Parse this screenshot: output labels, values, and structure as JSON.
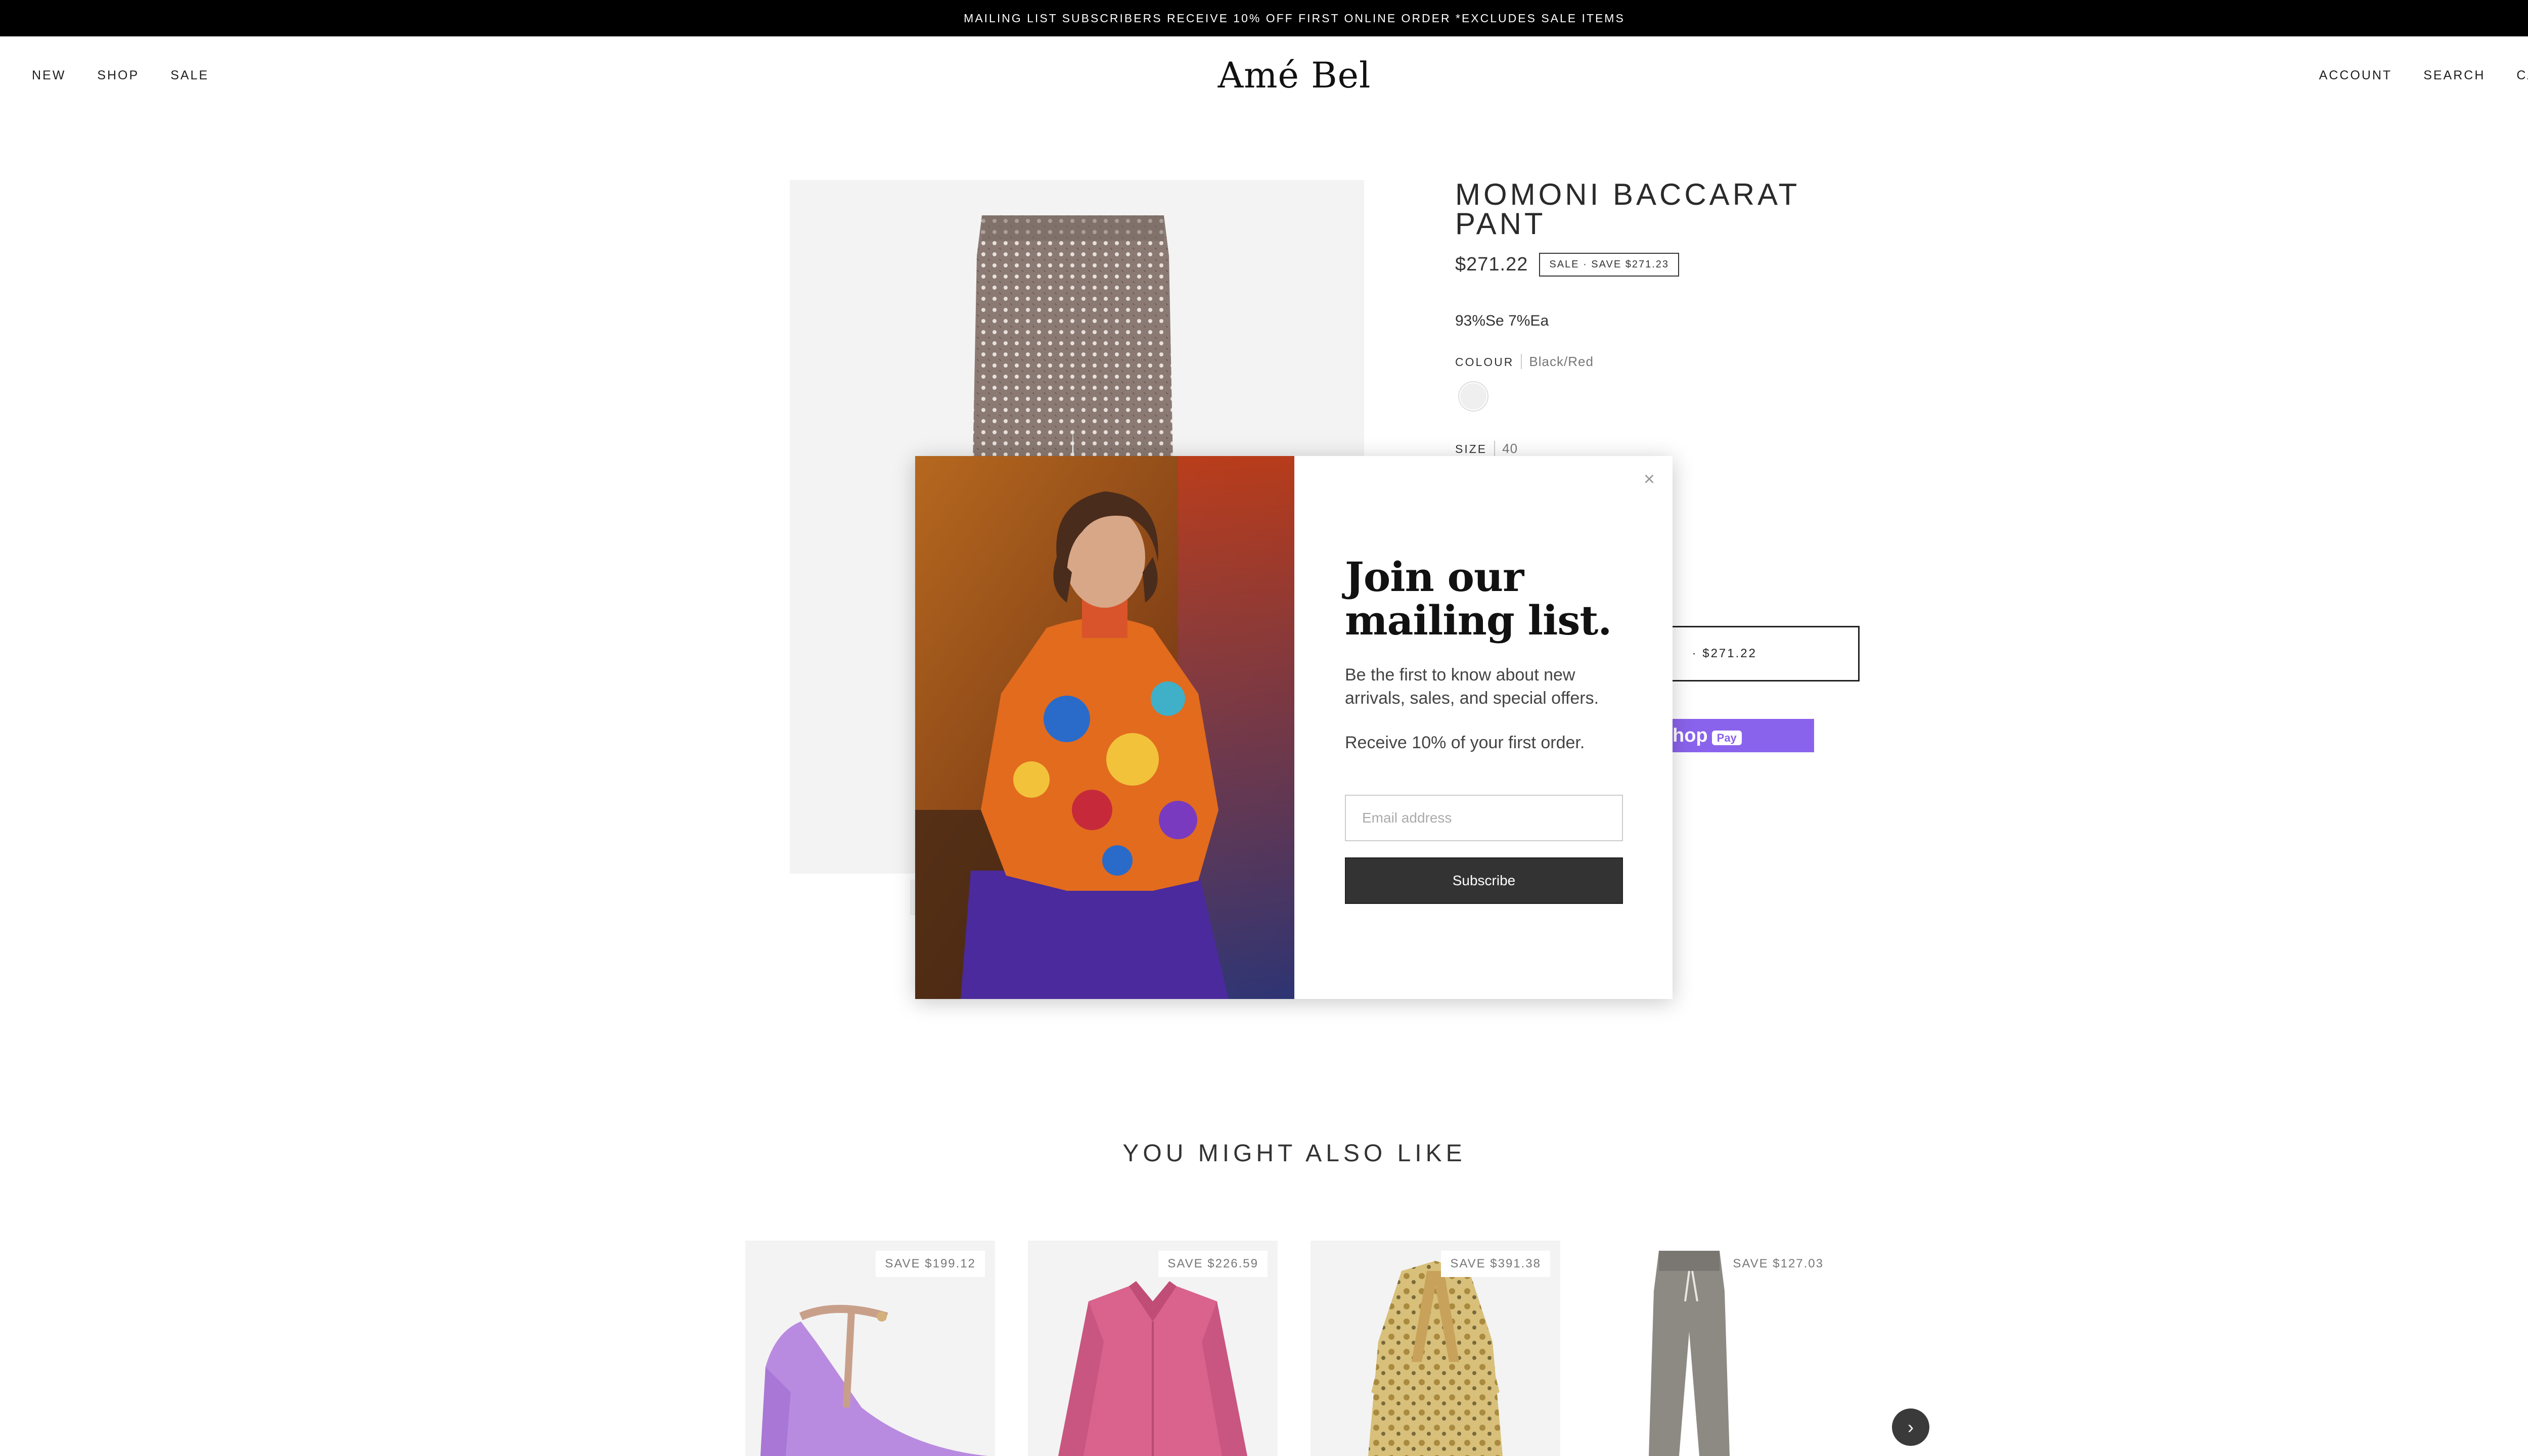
{
  "announcement": "MAILING LIST SUBSCRIBERS RECEIVE 10% OFF FIRST ONLINE ORDER *EXCLUDES SALE ITEMS",
  "header": {
    "nav_left": [
      "NEW",
      "SHOP",
      "SALE"
    ],
    "logo": "Amé Bel",
    "nav_right": [
      "ACCOUNT",
      "SEARCH",
      "CART"
    ]
  },
  "product": {
    "title": "MOMONI BACCARAT PANT",
    "price": "$271.22",
    "sale_badge": "SALE · SAVE $271.23",
    "composition": "93%Se 7%Ea",
    "colour_label": "COLOUR",
    "colour_value": "Black/Red",
    "size_label": "SIZE",
    "size_value": "40",
    "add_to_cart_price": "· $271.22",
    "shop_pay_text": "hop",
    "shop_pay_badge": "Pay"
  },
  "modal": {
    "close": "×",
    "title_line1": "Join our",
    "title_line2": "mailing list.",
    "text1": "Be the first to know about new arrivals, sales, and special offers.",
    "text2": "Receive 10% of your first order.",
    "email_placeholder": "Email address",
    "subscribe_label": "Subscribe"
  },
  "recommendations": {
    "title": "YOU MIGHT ALSO LIKE",
    "items": [
      {
        "save": "SAVE $199.12",
        "image": "lilac-heel"
      },
      {
        "save": "SAVE $226.59",
        "image": "pink-satin-shirt"
      },
      {
        "save": "SAVE $391.38",
        "image": "paisley-dress"
      },
      {
        "save": "SAVE $127.03",
        "image": "grey-jogger-pant"
      }
    ],
    "next_icon": "chevron-right-icon"
  },
  "colors": {
    "shop_pay": "#8a63ec",
    "announce_bg": "#000000",
    "subscribe_bg": "#333333"
  }
}
